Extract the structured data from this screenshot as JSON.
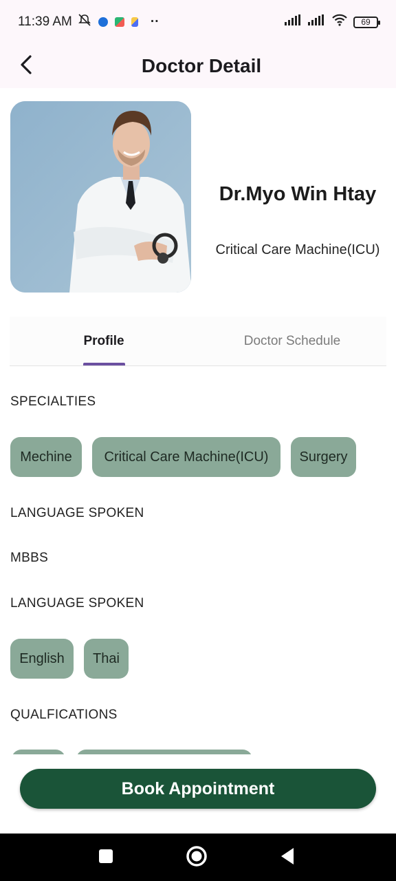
{
  "status_bar": {
    "time": "11:39 AM",
    "dots": "··",
    "battery": "69",
    "icons": [
      "bell-off-icon",
      "messenger-icon",
      "app-icon",
      "app-icon",
      "signal-icon",
      "signal-icon",
      "wifi-icon",
      "battery-icon"
    ]
  },
  "app_bar": {
    "title": "Doctor Detail",
    "back_icon": "chevron-left-icon"
  },
  "doctor": {
    "name": "Dr.Myo Win Htay",
    "specialty": "Critical Care Machine(ICU)"
  },
  "tabs": {
    "profile": "Profile",
    "schedule": "Doctor Schedule",
    "active": "Profile"
  },
  "profile": {
    "specialties_label": "SPECIALTIES",
    "specialties": [
      "Mechine",
      "Critical Care Machine(ICU)",
      "Surgery"
    ],
    "language_label_1": "LANGUAGE SPOKEN",
    "degree": "MBBS",
    "language_label_2": "LANGUAGE SPOKEN",
    "languages": [
      "English",
      "Thai"
    ],
    "qualifications_label": "QUALFICATIONS"
  },
  "actions": {
    "book": "Book Appointment"
  },
  "colors": {
    "chip": "#8aa998",
    "primary_button": "#1a5438",
    "tab_indicator": "#6b4fa0"
  }
}
